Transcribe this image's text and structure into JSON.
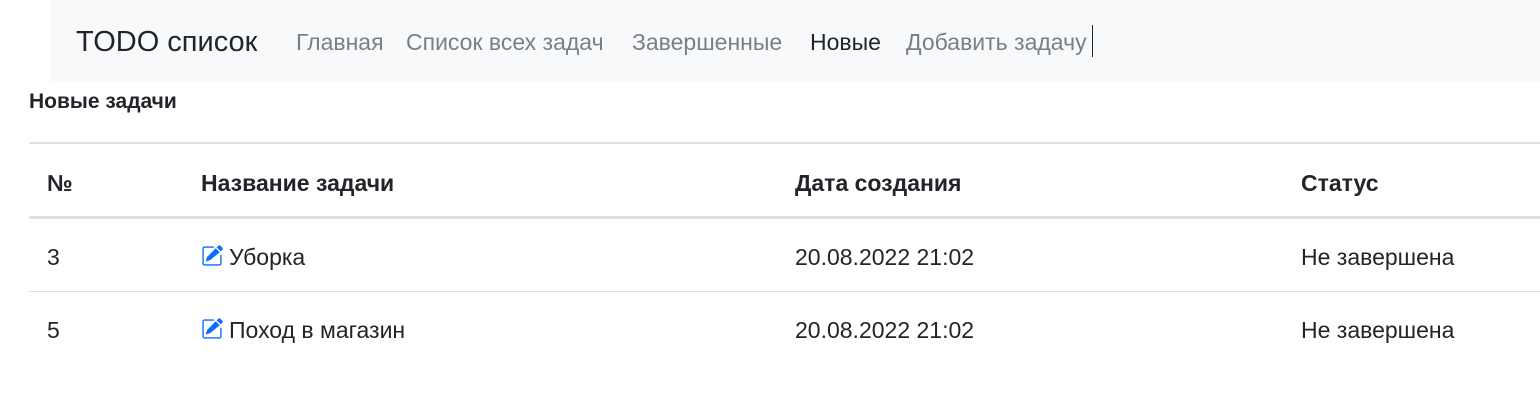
{
  "navbar": {
    "brand": "TODO список",
    "links": [
      {
        "label": "Главная"
      },
      {
        "label": "Список всех задач"
      },
      {
        "label": "Завершенные"
      },
      {
        "label": "Новые"
      },
      {
        "label": "Добавить задачу"
      }
    ],
    "active": "Новые"
  },
  "page": {
    "title": "Новые задачи"
  },
  "table": {
    "headers": [
      "№",
      "Название задачи",
      "Дата создания",
      "Статус"
    ],
    "rows": [
      {
        "id": "3",
        "name": "Уборка",
        "created": "20.08.2022 21:02",
        "status": "Не завершена"
      },
      {
        "id": "5",
        "name": "Поход в магазин",
        "created": "20.08.2022 21:02",
        "status": "Не завершена"
      }
    ]
  },
  "colors": {
    "accent": "#0d6efd",
    "navbar_bg": "#f8f9fa",
    "muted_link": "#7a7f84",
    "text": "#212529"
  },
  "icons": {
    "edit": "pencil-square-icon"
  }
}
